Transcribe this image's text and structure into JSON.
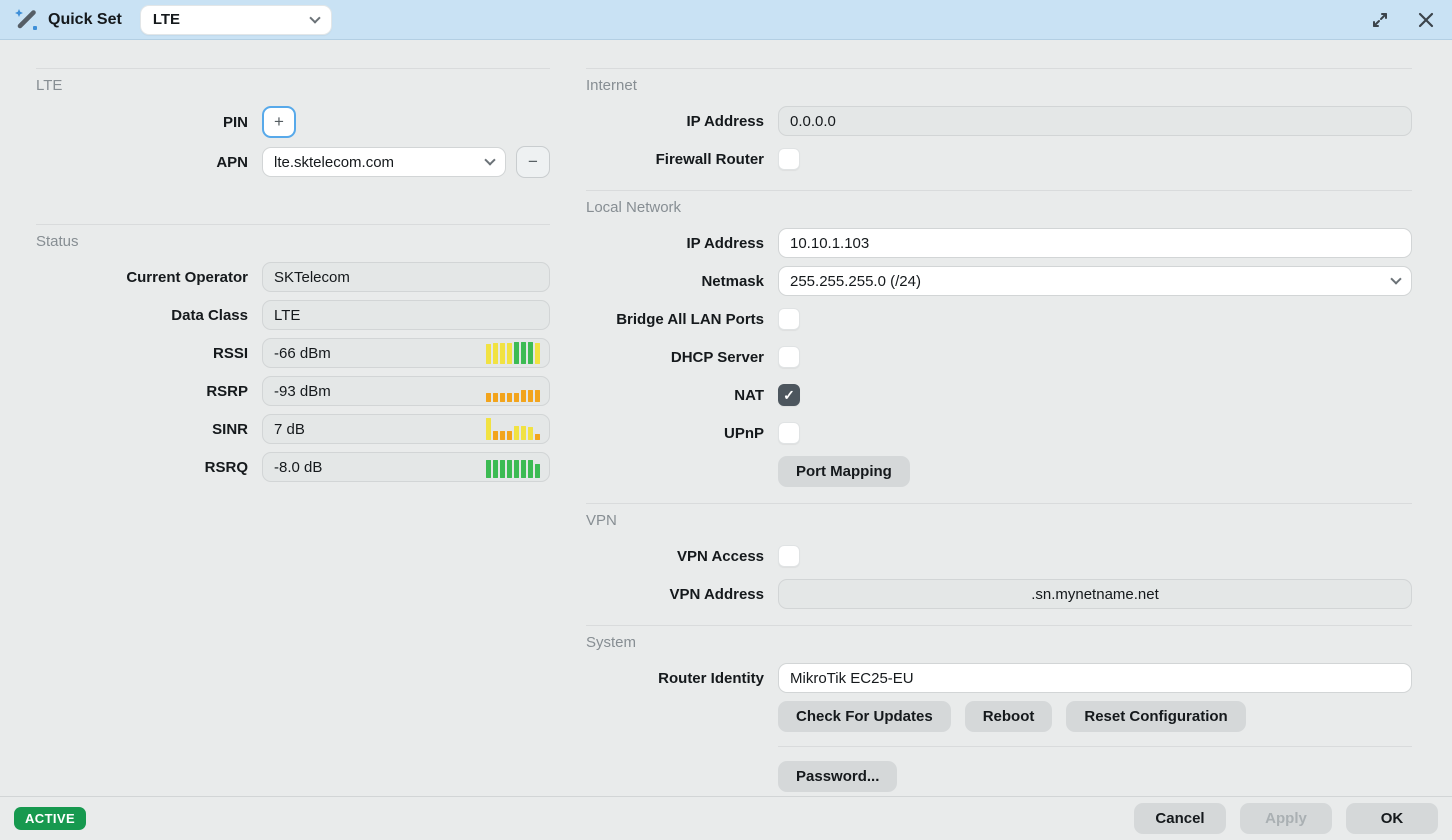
{
  "colors": {
    "titlebar_bg": "#c9e2f4",
    "window_bg": "#e9ebeb",
    "focus_blue": "#57a9ea",
    "active_green": "#17994f",
    "bar_yellow": "#f1e242",
    "bar_green": "#3cbb53",
    "bar_orange": "#f2a41c"
  },
  "titlebar": {
    "title": "Quick Set",
    "mode_value": "LTE"
  },
  "lte": {
    "header": "LTE",
    "pin_label": "PIN",
    "pin_add": "+",
    "apn_label": "APN",
    "apn_value": "lte.sktelecom.com",
    "apn_remove": "−"
  },
  "status": {
    "header": "Status",
    "operator_label": "Current Operator",
    "operator_value": "SKTelecom",
    "data_class_label": "Data Class",
    "data_class_value": "LTE",
    "rssi_label": "RSSI",
    "rssi_value": "-66 dBm",
    "rsrp_label": "RSRP",
    "rsrp_value": "-93 dBm",
    "sinr_label": "SINR",
    "sinr_value": "7 dB",
    "rsrq_label": "RSRQ",
    "rsrq_value": "-8.0 dB"
  },
  "signal_bars": {
    "rssi": [
      {
        "h": 0.85,
        "c": "yellow"
      },
      {
        "h": 0.9,
        "c": "yellow"
      },
      {
        "h": 0.9,
        "c": "yellow"
      },
      {
        "h": 0.9,
        "c": "yellow"
      },
      {
        "h": 0.95,
        "c": "green"
      },
      {
        "h": 0.95,
        "c": "green"
      },
      {
        "h": 0.95,
        "c": "green"
      },
      {
        "h": 0.9,
        "c": "yellow"
      }
    ],
    "rsrp": [
      {
        "h": 0.38,
        "c": "orange"
      },
      {
        "h": 0.38,
        "c": "orange"
      },
      {
        "h": 0.38,
        "c": "orange"
      },
      {
        "h": 0.38,
        "c": "orange"
      },
      {
        "h": 0.38,
        "c": "orange"
      },
      {
        "h": 0.52,
        "c": "orange"
      },
      {
        "h": 0.52,
        "c": "orange"
      },
      {
        "h": 0.52,
        "c": "orange"
      }
    ],
    "sinr": [
      {
        "h": 0.95,
        "c": "yellow"
      },
      {
        "h": 0.4,
        "c": "orange"
      },
      {
        "h": 0.4,
        "c": "orange"
      },
      {
        "h": 0.4,
        "c": "orange"
      },
      {
        "h": 0.6,
        "c": "yellow"
      },
      {
        "h": 0.6,
        "c": "yellow"
      },
      {
        "h": 0.55,
        "c": "yellow"
      },
      {
        "h": 0.25,
        "c": "orange"
      }
    ],
    "rsrq": [
      {
        "h": 0.78,
        "c": "green"
      },
      {
        "h": 0.78,
        "c": "green"
      },
      {
        "h": 0.78,
        "c": "green"
      },
      {
        "h": 0.78,
        "c": "green"
      },
      {
        "h": 0.78,
        "c": "green"
      },
      {
        "h": 0.78,
        "c": "green"
      },
      {
        "h": 0.78,
        "c": "green"
      },
      {
        "h": 0.6,
        "c": "green"
      }
    ]
  },
  "internet": {
    "header": "Internet",
    "ip_label": "IP Address",
    "ip_value": "0.0.0.0",
    "firewall_label": "Firewall Router",
    "firewall_checked": false
  },
  "local_network": {
    "header": "Local Network",
    "ip_label": "IP Address",
    "ip_value": "10.10.1.103",
    "netmask_label": "Netmask",
    "netmask_value": "255.255.255.0 (/24)",
    "bridge_label": "Bridge All LAN Ports",
    "bridge_checked": false,
    "dhcp_label": "DHCP Server",
    "dhcp_checked": false,
    "nat_label": "NAT",
    "nat_checked": true,
    "upnp_label": "UPnP",
    "upnp_checked": false,
    "port_mapping_label": "Port Mapping"
  },
  "vpn": {
    "header": "VPN",
    "access_label": "VPN Access",
    "access_checked": false,
    "address_label": "VPN Address",
    "address_value": ".sn.mynetname.net"
  },
  "system": {
    "header": "System",
    "identity_label": "Router Identity",
    "identity_value": "MikroTik EC25-EU",
    "check_updates_label": "Check For Updates",
    "reboot_label": "Reboot",
    "reset_label": "Reset Configuration",
    "password_label": "Password..."
  },
  "footer": {
    "status_badge": "ACTIVE",
    "cancel_label": "Cancel",
    "apply_label": "Apply",
    "ok_label": "OK"
  },
  "glyphs": {
    "check": "✓"
  }
}
